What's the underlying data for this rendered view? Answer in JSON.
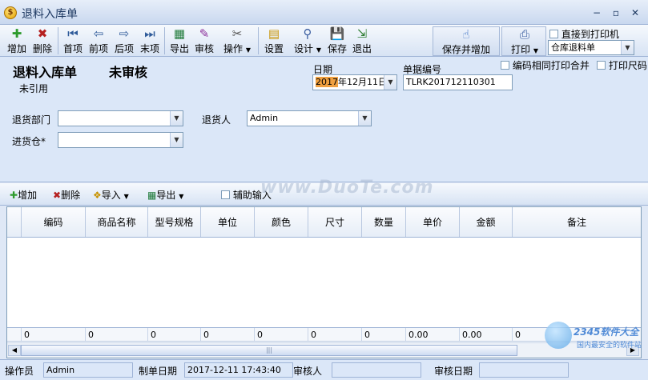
{
  "window": {
    "title": "退料入库单",
    "minimize": "−",
    "restore": "▫",
    "close": "✕"
  },
  "toolbar": {
    "add": "增加",
    "delete": "删除",
    "first": "首项",
    "prev": "前项",
    "next": "后项",
    "last": "末项",
    "export": "导出",
    "audit": "审核",
    "operate": "操作",
    "settings": "设置",
    "design": "设计",
    "save": "保存",
    "exit": "退出",
    "save_and_add": "保存并增加",
    "print": "打印",
    "direct_print_label": "直接到打印机",
    "print_template": "仓库退料单",
    "merge_same_code_label": "编码相同打印合并",
    "print_size_label": "打印尺码"
  },
  "form": {
    "doc_title": "退料入库单",
    "audit_status": "未审核",
    "ref_status": "未引用",
    "date_label": "日期",
    "date_year": "2017",
    "date_rest": "年12月11日",
    "doc_no_label": "单据编号",
    "doc_no": "TLRK201712110301",
    "dept_label": "退货部门",
    "dept_value": "",
    "returner_label": "退货人",
    "returner_value": "Admin",
    "warehouse_label": "进货仓*",
    "warehouse_value": ""
  },
  "grid_toolbar": {
    "add": "增加",
    "delete": "删除",
    "import": "导入",
    "export": "导出",
    "assist_label": "辅助输入"
  },
  "grid": {
    "columns": [
      "编码",
      "商品名称",
      "型号规格",
      "单位",
      "颜色",
      "尺寸",
      "数量",
      "单价",
      "金额",
      "备注"
    ],
    "totals": [
      "0",
      "0",
      "0",
      "0",
      "0",
      "0",
      "0",
      "0.00",
      "0.00",
      "0"
    ]
  },
  "status": {
    "operator_label": "操作员",
    "operator": "Admin",
    "made_date_label": "制单日期",
    "made_date": "2017-12-11 17:43:40",
    "auditor_label": "审核人",
    "auditor": "",
    "audit_date_label": "审核日期",
    "audit_date": ""
  },
  "watermarks": {
    "duote": "www.DuoTe.com",
    "site_name": "2345软件大全",
    "site_sub": "国内最安全的软件站"
  },
  "colors": {
    "frame": "#dfe8f6",
    "border": "#9eb3d6",
    "title_text": "#1e3962"
  },
  "icons": [
    "app-icon",
    "add-icon",
    "delete-icon",
    "first-icon",
    "prev-icon",
    "next-icon",
    "last-icon",
    "export-icon",
    "audit-icon",
    "operate-icon",
    "settings-icon",
    "design-icon",
    "save-icon",
    "exit-icon",
    "save-add-icon",
    "print-icon"
  ]
}
